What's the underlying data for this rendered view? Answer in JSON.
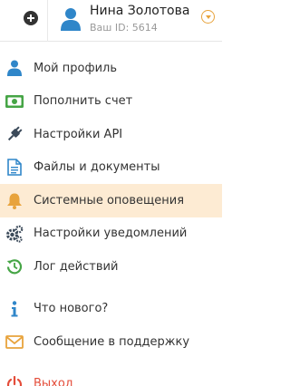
{
  "header": {
    "user_name": "Нина Золотова",
    "user_id": "Ваш ID: 5614"
  },
  "menu": {
    "items": [
      {
        "label": "Мой профиль",
        "icon": "user-icon"
      },
      {
        "label": "Пополнить счет",
        "icon": "money-icon"
      },
      {
        "label": "Настройки API",
        "icon": "plug-icon"
      },
      {
        "label": "Файлы и документы",
        "icon": "document-icon"
      },
      {
        "label": "Системные оповещения",
        "icon": "bell-icon",
        "active": true
      },
      {
        "label": "Настройки уведомлений",
        "icon": "gears-icon"
      },
      {
        "label": "Лог действий",
        "icon": "history-icon"
      },
      {
        "label": "Что нового?",
        "icon": "info-icon"
      },
      {
        "label": "Сообщение в поддержку",
        "icon": "envelope-icon"
      },
      {
        "label": "Выход",
        "icon": "power-icon"
      }
    ]
  },
  "colors": {
    "accent": "#e8a33c",
    "active_bg": "#fdebd3",
    "blue": "#2f86c9",
    "green": "#46a546",
    "slate": "#3b4a5a",
    "red": "#e44d3a"
  }
}
